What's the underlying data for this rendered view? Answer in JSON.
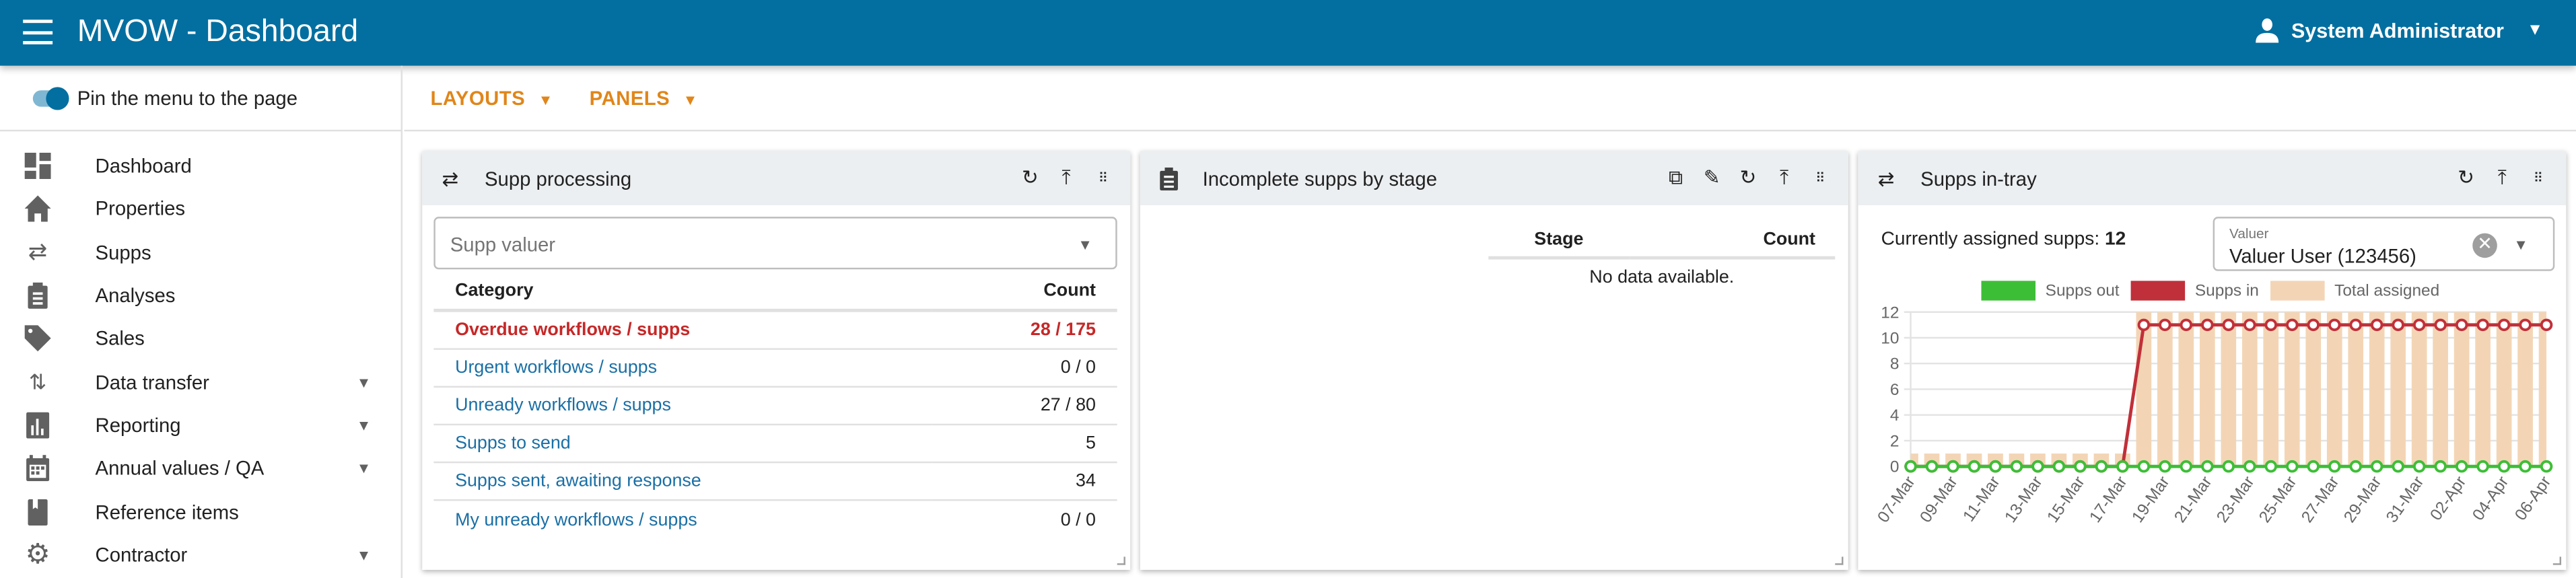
{
  "header": {
    "title": "MVOW - Dashboard",
    "user": "System Administrator",
    "menu_icon": "hamburger-icon",
    "user_icon": "person-icon",
    "brand_color": "#036fa0"
  },
  "sidebar": {
    "pin_label": "Pin the menu to the page",
    "pin_on": true,
    "items": [
      {
        "label": "Dashboard",
        "icon": "dashboard-icon",
        "expandable": false
      },
      {
        "label": "Properties",
        "icon": "home-icon",
        "expandable": false
      },
      {
        "label": "Supps",
        "icon": "swap-icon",
        "expandable": false
      },
      {
        "label": "Analyses",
        "icon": "clipboard-icon",
        "expandable": false
      },
      {
        "label": "Sales",
        "icon": "tag-icon",
        "expandable": false
      },
      {
        "label": "Data transfer",
        "icon": "transfer-icon",
        "expandable": true
      },
      {
        "label": "Reporting",
        "icon": "chart-icon",
        "expandable": true
      },
      {
        "label": "Annual values / QA",
        "icon": "calendar-icon",
        "expandable": true
      },
      {
        "label": "Reference items",
        "icon": "bookmark-icon",
        "expandable": false
      },
      {
        "label": "Contractor",
        "icon": "gear-icon",
        "expandable": true
      }
    ]
  },
  "toolbar": {
    "layouts": "LAYOUTS",
    "panels": "PANELS",
    "accent": "#e0861a"
  },
  "panel1": {
    "title": "Supp processing",
    "select_placeholder": "Supp valuer",
    "columns": [
      "Category",
      "Count"
    ],
    "rows": [
      {
        "category": "Overdue workflows / supps",
        "count": "28 / 175",
        "highlight": true
      },
      {
        "category": "Urgent workflows / supps",
        "count": "0 / 0"
      },
      {
        "category": "Unready workflows / supps",
        "count": "27 / 80"
      },
      {
        "category": "Supps to send",
        "count": "5"
      },
      {
        "category": "Supps sent, awaiting response",
        "count": "34"
      },
      {
        "category": "My unready workflows / supps",
        "count": "0 / 0"
      }
    ]
  },
  "panel2": {
    "title": "Incomplete supps by stage",
    "columns": [
      "Stage",
      "Count"
    ],
    "empty": "No data available."
  },
  "panel3": {
    "title": "Supps in-tray",
    "assigned_label": "Currently assigned supps:",
    "assigned_value": "12",
    "valuer_label": "Valuer",
    "valuer_value": "Valuer User (123456)"
  },
  "chart_data": {
    "type": "bar+line",
    "x": [
      "07-Mar",
      "08-Mar",
      "09-Mar",
      "10-Mar",
      "11-Mar",
      "12-Mar",
      "13-Mar",
      "14-Mar",
      "15-Mar",
      "16-Mar",
      "17-Mar",
      "18-Mar",
      "19-Mar",
      "20-Mar",
      "21-Mar",
      "22-Mar",
      "23-Mar",
      "24-Mar",
      "25-Mar",
      "26-Mar",
      "27-Mar",
      "28-Mar",
      "29-Mar",
      "30-Mar",
      "31-Mar",
      "01-Apr",
      "02-Apr",
      "03-Apr",
      "04-Apr",
      "05-Apr",
      "06-Apr"
    ],
    "ylim": [
      0,
      12
    ],
    "yticks": [
      0,
      2,
      4,
      6,
      8,
      10,
      12
    ],
    "grid": true,
    "legend_position": "top",
    "series": [
      {
        "name": "Supps out",
        "type": "line",
        "color": "#3dbe37",
        "values": [
          0,
          0,
          0,
          0,
          0,
          0,
          0,
          0,
          0,
          0,
          0,
          0,
          0,
          0,
          0,
          0,
          0,
          0,
          0,
          0,
          0,
          0,
          0,
          0,
          0,
          0,
          0,
          0,
          0,
          0,
          0
        ]
      },
      {
        "name": "Supps in",
        "type": "line",
        "color": "#c0303a",
        "values": [
          0,
          0,
          0,
          0,
          0,
          0,
          0,
          0,
          0,
          0,
          0,
          11,
          11,
          11,
          11,
          11,
          11,
          11,
          11,
          11,
          11,
          11,
          11,
          11,
          11,
          11,
          11,
          11,
          11,
          11,
          11
        ]
      },
      {
        "name": "Total assigned",
        "type": "bar",
        "color": "#f3d5b5",
        "values": [
          1,
          1,
          1,
          1,
          1,
          1,
          1,
          1,
          1,
          1,
          1,
          12,
          12,
          12,
          12,
          12,
          12,
          12,
          12,
          12,
          12,
          12,
          12,
          12,
          12,
          12,
          12,
          12,
          12,
          12,
          12
        ]
      }
    ]
  }
}
